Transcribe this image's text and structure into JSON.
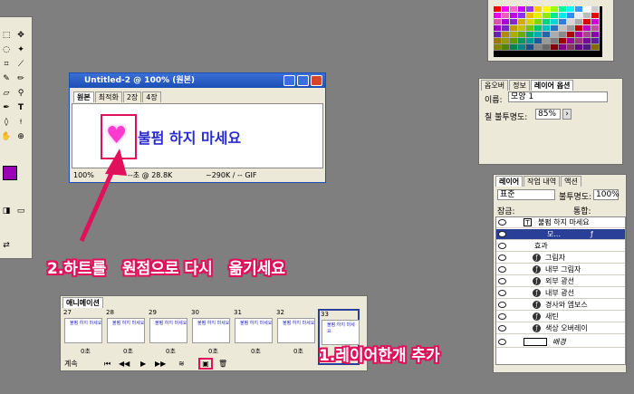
{
  "doc_window": {
    "title": "Untitled-2 @ 100% (원본)",
    "tabs": [
      "원본",
      "최적화",
      "2장",
      "4장"
    ],
    "canvas_text": "불펌 하지 마세요",
    "status": [
      "100%",
      "--초 @ 28.8K",
      "~290K / -- GIF"
    ]
  },
  "options_panel": {
    "tabs": [
      "옵오버",
      "정보",
      "레이어 옵션"
    ],
    "name_label": "이름:",
    "name_value": "모양 1",
    "opacity_label": "칠 불투명도:",
    "opacity_value": "85%"
  },
  "layers_panel": {
    "tabs": [
      "레이어",
      "작업 내역",
      "액션"
    ],
    "blend_mode": "표준",
    "opacity_label": "불투명도:",
    "opacity_value": "100%",
    "lock_label": "잠금:",
    "merge_label": "통합:",
    "layers": [
      {
        "name": "불펌 하지 마세요"
      },
      {
        "name": "모..."
      },
      {
        "name": "효과"
      },
      {
        "name": "그림자"
      },
      {
        "name": "내부 그림자"
      },
      {
        "name": "외부 광선"
      },
      {
        "name": "내부 광선"
      },
      {
        "name": "경사와 엠보스"
      },
      {
        "name": "새틴"
      },
      {
        "name": "색상 오버레이"
      },
      {
        "name": "배경"
      }
    ]
  },
  "animation_panel": {
    "tab": "애니메이션",
    "frames": [
      {
        "num": "27",
        "dur": "0초"
      },
      {
        "num": "28",
        "dur": "0초"
      },
      {
        "num": "29",
        "dur": "0초"
      },
      {
        "num": "30",
        "dur": "0초"
      },
      {
        "num": "31",
        "dur": "0초"
      },
      {
        "num": "32",
        "dur": "0초"
      },
      {
        "num": "33",
        "dur": "0초"
      }
    ],
    "loop": "계속"
  },
  "annotations": {
    "step2": "2.하트를   원점으로 다시   옮기세요",
    "step1": "1.레이어한개 추가"
  },
  "colors": {
    "annotation_pink": "#e0115a",
    "heart": "#ff3bcf",
    "canvas_text": "#2a2ad0",
    "foreground_swatch": "#9a00b4"
  },
  "icons": [
    "heart-icon",
    "eye-icon",
    "fx-icon",
    "arrow-icon"
  ]
}
